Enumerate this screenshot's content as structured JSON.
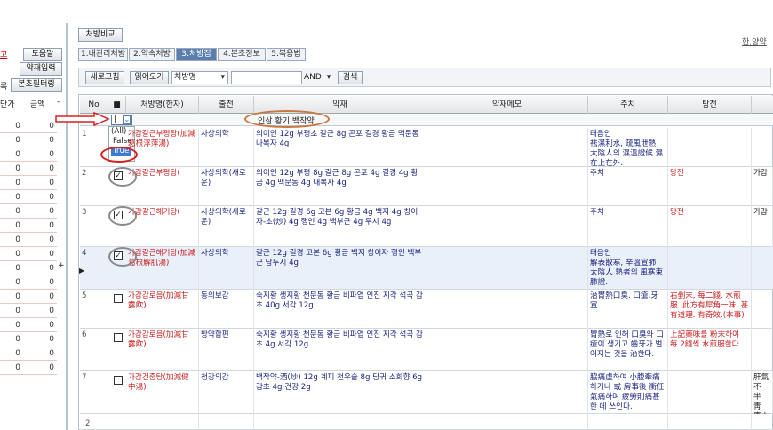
{
  "top_right_link": "한,양약",
  "left_pane": {
    "link1": "고",
    "button_help": "도움말",
    "button_drug_input": "약재입력",
    "label_fragment": "록",
    "button_filter": "본초필터링",
    "header_price": "단가",
    "header_amount": "금액",
    "header_dash": "-",
    "rows": [
      "0",
      "0",
      "0",
      "0",
      "0",
      "0",
      "0",
      "0",
      "0",
      "0",
      "0",
      "0",
      "0",
      "0",
      "0",
      "0",
      "0",
      "0"
    ],
    "plus": "+",
    "bottom_value": "0"
  },
  "toolbar": {
    "compare_button": "처방비교",
    "tabs": [
      "1.내관리처방",
      "2.약속처방",
      "3.처방집",
      "4.본초정보",
      "5.복용법"
    ],
    "active_tab": 2,
    "refresh_button": "새로고침",
    "load_button": "읽어오기",
    "field_select": "처방명",
    "and_select": "AND",
    "search_button": "검색"
  },
  "grid": {
    "headers": [
      "No",
      "■",
      "처방명(한자)",
      "출전",
      "약재",
      "약재메모",
      "주치",
      "탕전"
    ],
    "filter_text": "인삼 황기 백작약",
    "filter_options": [
      "(All)",
      "False",
      "True"
    ],
    "rows": [
      {
        "no": "1",
        "checked": false,
        "name": "가감갈근부평탕(加減葛根浮萍湯)",
        "src": "사상의학",
        "drugs": "의이인 12g 부평초 갈근 8g 곤포 길경 황금 맥문동 나복자 4g",
        "memo": "",
        "indication": "태음인 \n祛濕利水, 疏風泄熱. 太陰人의 濕溫證候 濕在上在外.",
        "decoction": ""
      },
      {
        "no": "2",
        "checked": true,
        "name": "가감갈근부평탕(",
        "src": "사상의학(새로운)",
        "drugs": "의이인 12g 부평 8g 갈근 8g 곤포 4g 길경 4g 황금 4g 맥문동 4g 내복자 4g",
        "memo": "",
        "indication": "주치",
        "decoction": "탕전",
        "extra": "가감"
      },
      {
        "no": "3",
        "checked": true,
        "name": "가감갈근해기탕(",
        "src": "사상의학(새로운)",
        "drugs": "갈근 12g 길경 6g 고본 6g 황금 4g 백지 4g 창이자-초(炒) 4g 행인 4g 백부근 4g 두시 4g",
        "memo": "",
        "indication": "주치",
        "decoction": "탕전",
        "extra": "가감"
      },
      {
        "no": "4",
        "checked": true,
        "name": "가감갈근해기탕(加減葛根解肌湯)",
        "src": "사상의학",
        "drugs": "갈근 12g 길경 고본 6g 황금 백지 창이자 행인 백부근 담두시 4g",
        "memo": "",
        "indication": "태음인 \n解表散寒, 辛溫宣肺. 太陰人 熱者의 風寒束肺證.",
        "decoction": ""
      },
      {
        "no": "5",
        "checked": false,
        "name": "가감감로음(加減甘露飮)",
        "src": "동의보감",
        "drugs": "숙지황 생지황 천문동 황금 비파엽 인진 지각 석곡 감초 40g 서각 12g",
        "memo": "",
        "indication": "治胃熱口臭. 口瘡.牙宣.",
        "decoction": "右剉末, 每二錢. 水煎服. 此方有犀角一味, 甚有道理. 有奇效.(本事)"
      },
      {
        "no": "6",
        "checked": false,
        "name": "가감감로음(加減甘露飮)",
        "src": "방약합편",
        "drugs": "숙지황 생지황 천문동 황금 비파엽 인진 지각 석곡 감초 4g 서각 12g",
        "memo": "",
        "indication": "胃熱로 인해 口臭와 口瘡이 생기고 齒牙가 벌어지는 것을 治한다.",
        "decoction": "上記藥味를 粉末하여 每 2錢씩 水煎服한다."
      },
      {
        "no": "7",
        "checked": false,
        "name": "가감건중탕(加減健中湯)",
        "src": "청강의감",
        "drugs": "백작약-酒(炒) 12g 계피 천우슬 8g 당귀 소회향 6g 감초 4g 건강 2g",
        "memo": "",
        "indication": "脇痛虛하여 小腹牽痛하거나 或 房事後 衝任氣痛하며 疲勞則痛甚한 데 쓰인다.",
        "decoction": "",
        "extra": "肝氣不 半 靑 唐木鉤 地黃二"
      },
      {
        "no": "",
        "checked": false,
        "name": "",
        "src": "",
        "drugs": "",
        "memo": "",
        "indication": "",
        "decoction": ""
      }
    ],
    "group_label": "2"
  },
  "colors": {
    "accent": "#5a7fae",
    "red_text": "#c82020",
    "navy_text": "#1a237e"
  }
}
